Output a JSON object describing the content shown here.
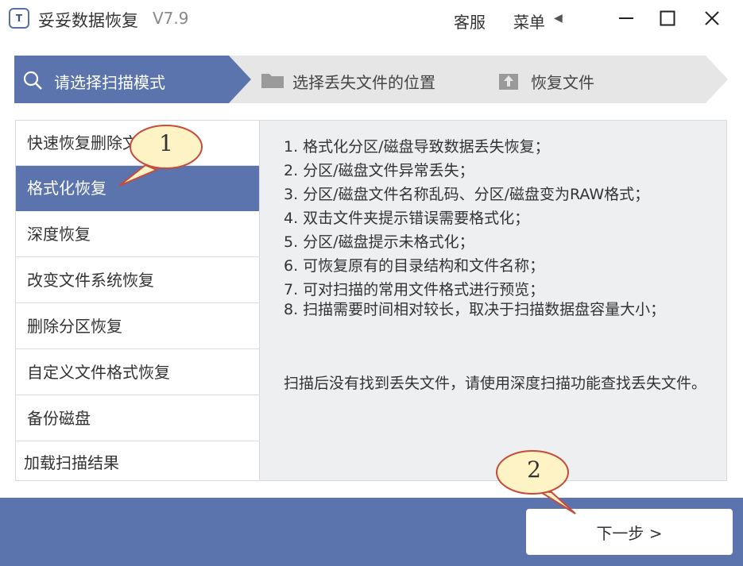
{
  "window": {
    "logo_text": "T",
    "title": "妥妥数据恢复",
    "version": "V7.9",
    "support_label": "客服",
    "menu_label": "菜单",
    "menu_arrow": "◀"
  },
  "steps": [
    {
      "label": "请选择扫描模式",
      "icon": "search-icon",
      "active": true
    },
    {
      "label": "选择丢失文件的位置",
      "icon": "folder-icon",
      "active": false
    },
    {
      "label": "恢复文件",
      "icon": "upload-icon",
      "active": false
    }
  ],
  "modes": [
    {
      "label": "快速恢复删除文件",
      "selected": false
    },
    {
      "label": "格式化恢复",
      "selected": true
    },
    {
      "label": "深度恢复",
      "selected": false
    },
    {
      "label": "改变文件系统恢复",
      "selected": false
    },
    {
      "label": "删除分区恢复",
      "selected": false
    },
    {
      "label": "自定义文件格式恢复",
      "selected": false
    },
    {
      "label": "备份磁盘",
      "selected": false
    },
    {
      "label": "加载扫描结果",
      "selected": false
    }
  ],
  "description": {
    "lines": [
      "1. 格式化分区/磁盘导致数据丢失恢复；",
      "2. 分区/磁盘文件异常丢失；",
      "3. 分区/磁盘文件名称乱码、分区/磁盘变为RAW格式；",
      "4. 双击文件夹提示错误需要格式化；",
      "5. 分区/磁盘提示未格式化；",
      "6. 可恢复原有的目录结构和文件名称；",
      "7. 可对扫描的常用文件格式进行预览；",
      "8. 扫描需要时间相对较长，取决于扫描数据盘容量大小；"
    ],
    "note": "扫描后没有找到丢失文件，请使用深度扫描功能查找丢失文件。"
  },
  "next_button": {
    "label": "下一步 >"
  },
  "callouts": [
    {
      "number": "1"
    },
    {
      "number": "2"
    }
  ],
  "colors": {
    "accent": "#5b74ad",
    "step_inactive": "#e6e6e6",
    "panel_bg": "#eeeff1",
    "callout_fill": "#fdf3c4",
    "callout_stroke": "#c84a3a"
  }
}
